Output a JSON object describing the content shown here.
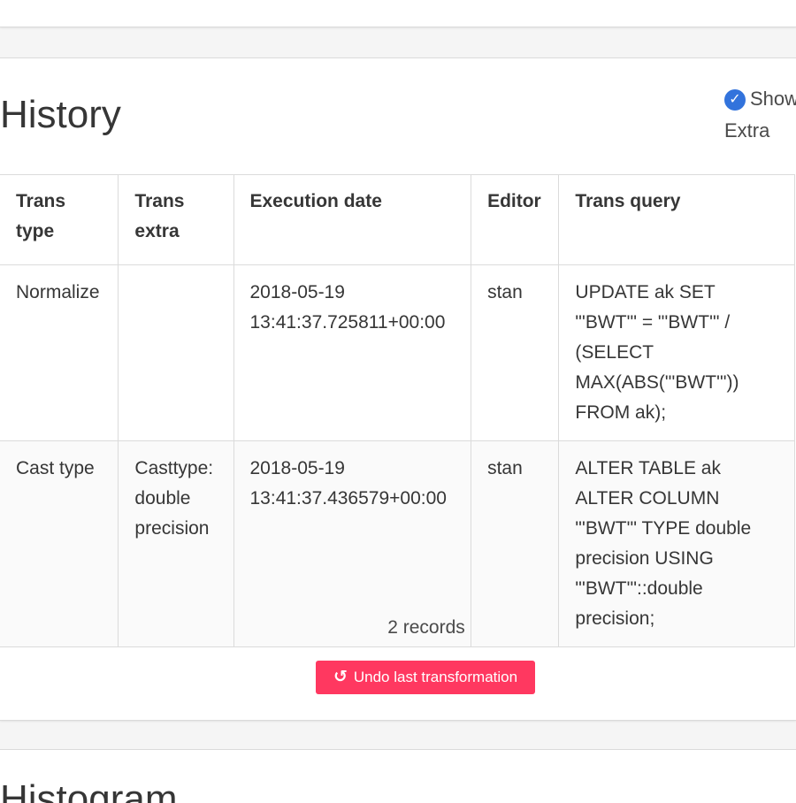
{
  "history": {
    "title": "History",
    "show_extra_label_1": "Show",
    "show_extra_label_2": "Extra",
    "show_extra_checked": true,
    "columns": [
      "Trans type",
      "Trans extra",
      "Execution date",
      "Editor",
      "Trans query"
    ],
    "rows": [
      {
        "trans_type": "Normalize",
        "trans_extra": "",
        "execution_date": "2018-05-19 13:41:37.725811+00:00",
        "editor": "stan",
        "trans_query": "UPDATE ak SET \"'BWT'\" = \"'BWT'\" / (SELECT MAX(ABS(\"'BWT'\")) FROM ak);"
      },
      {
        "trans_type": "Cast type",
        "trans_extra": "Casttype: double precision",
        "execution_date": "2018-05-19 13:41:37.436579+00:00",
        "editor": "stan",
        "trans_query": "ALTER TABLE ak ALTER COLUMN \"'BWT'\" TYPE double precision USING \"'BWT'\"::double precision;"
      }
    ],
    "records_text": "2 records",
    "undo_label": "Undo last transformation",
    "undo_icon": "undo-icon"
  },
  "histogram": {
    "title": "Histogram"
  },
  "colors": {
    "accent": "#3273dc",
    "danger": "#ff3860",
    "text": "#363636",
    "border": "#dbdbdb",
    "background": "#f5f5f5"
  }
}
